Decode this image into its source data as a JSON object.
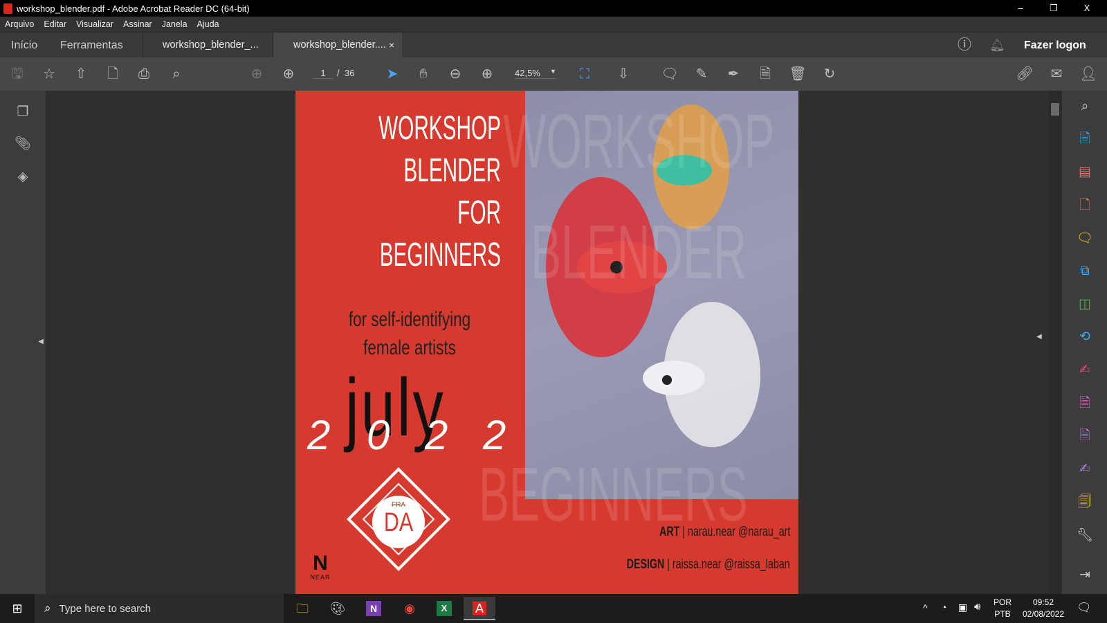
{
  "window": {
    "title": "workshop_blender.pdf - Adobe Acrobat Reader DC (64-bit)",
    "minimize": "–",
    "maximize": "❐",
    "close": "X"
  },
  "menu": [
    "Arquivo",
    "Editar",
    "Visualizar",
    "Assinar",
    "Janela",
    "Ajuda"
  ],
  "tabs": {
    "home": "Início",
    "tools": "Ferramentas",
    "doc1": "workshop_blender_...",
    "doc2": "workshop_blender....",
    "close": "×",
    "login": "Fazer logon"
  },
  "toolbar": {
    "page_current": "1",
    "page_sep": "/",
    "page_total": "36",
    "zoom": "42,5%"
  },
  "poster": {
    "title": [
      "WORKSHOP",
      "BLENDER",
      "FOR",
      "BEGINNERS"
    ],
    "subtitle": [
      "for self-identifying",
      "female artists"
    ],
    "month": "july",
    "year": [
      "2",
      "0",
      "2",
      "2"
    ],
    "logo_top": "FRA",
    "logo_main": "DA",
    "near": "NEAR",
    "credits": [
      {
        "role": "ART",
        "text": "| narau.near @narau_art"
      },
      {
        "role": "DESIGN",
        "text": "| raissa.near @raissa_laban"
      }
    ]
  },
  "taskbar": {
    "search_placeholder": "Type here to search",
    "lang1": "POR",
    "lang2": "PTB",
    "time": "09:52",
    "date": "02/08/2022"
  },
  "colors": {
    "poster_red": "#d63a2e",
    "accent_blue": "#4aa3f5"
  }
}
